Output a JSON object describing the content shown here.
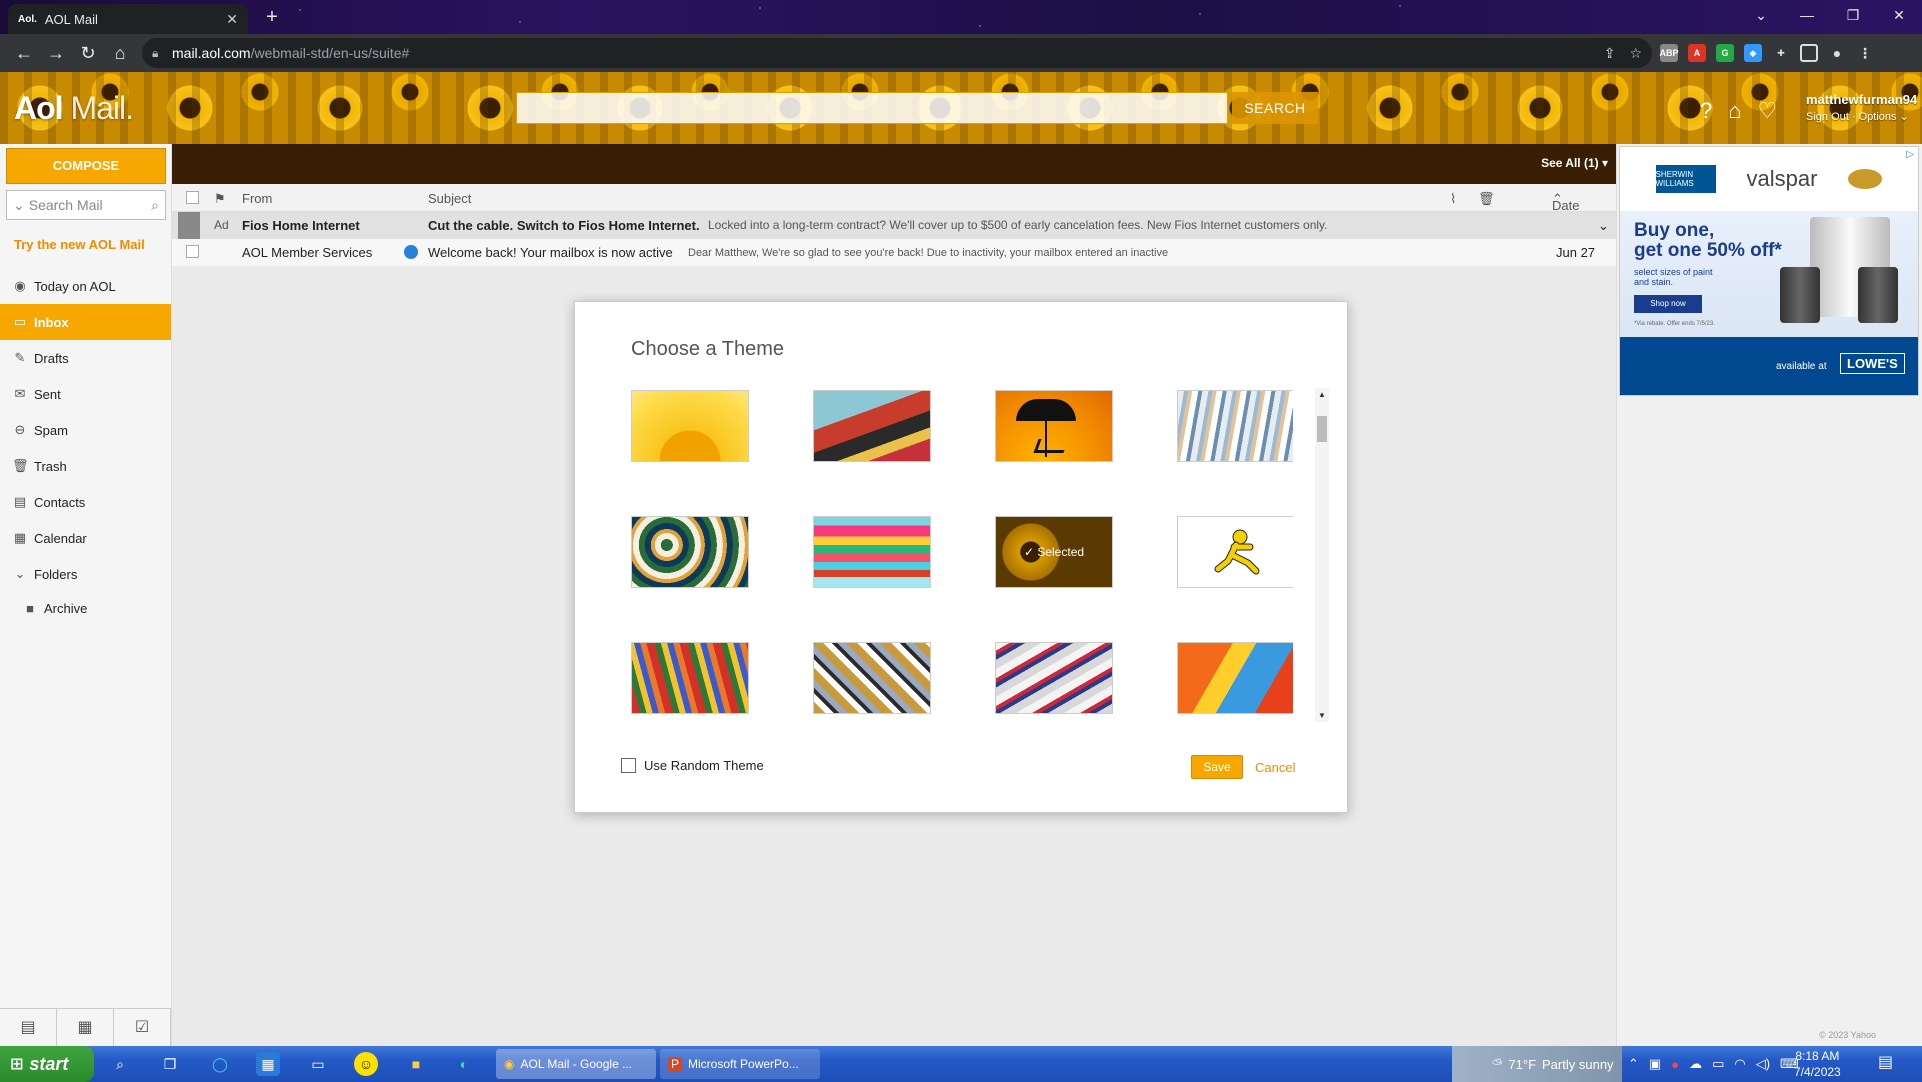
{
  "browser": {
    "tab_title": "AOL Mail",
    "tab_favicon": "Aol.",
    "url_host": "mail.aol.com",
    "url_path": "/webmail-std/en-us/suite#"
  },
  "header": {
    "logo_bold": "Aol",
    "logo_light": "Mail.",
    "search_button": "SEARCH",
    "username": "matthewfurman94",
    "sign_out": "Sign Out",
    "options": "Options"
  },
  "sidebar": {
    "compose": "COMPOSE",
    "search_placeholder": "Search Mail",
    "try_new": "Try the new AOL Mail",
    "items": [
      {
        "label": "Today on AOL",
        "icon": "aol-icon"
      },
      {
        "label": "Inbox",
        "icon": "inbox-icon"
      },
      {
        "label": "Drafts",
        "icon": "drafts-icon"
      },
      {
        "label": "Sent",
        "icon": "sent-icon"
      },
      {
        "label": "Spam",
        "icon": "spam-icon"
      },
      {
        "label": "Trash",
        "icon": "trash-icon"
      },
      {
        "label": "Contacts",
        "icon": "contacts-icon"
      },
      {
        "label": "Calendar",
        "icon": "calendar-icon"
      },
      {
        "label": "Folders",
        "icon": "chevron-down-icon"
      },
      {
        "label": "Archive",
        "icon": "folder-icon"
      }
    ]
  },
  "list": {
    "see_all": "See All (1)",
    "col_from": "From",
    "col_subject": "Subject",
    "col_date": "Date",
    "rows": [
      {
        "tag": "Ad",
        "from": "Fios Home Internet",
        "subject": "Cut the cable. Switch to Fios Home Internet.",
        "preview": "Locked into a long-term contract? We'll cover up to $500 of early cancelation fees. New Fios Internet customers only.",
        "date": ""
      },
      {
        "tag": "",
        "from": "AOL Member Services",
        "subject": "Welcome back! Your mailbox is now active",
        "preview": "Dear Matthew, We're so glad to see you're back! Due to inactivity, your mailbox entered an inactive",
        "date": "Jun 27"
      }
    ]
  },
  "ad": {
    "brand1": "SHERWIN WILLIAMS",
    "brand2": "valspar",
    "headline1": "Buy one,",
    "headline2": "get one 50% off*",
    "sub": "select sizes of paint and stain.",
    "cta": "Shop now",
    "fine": "*Via rebate. Offer ends 7/5/23.",
    "available": "available at",
    "retailer": "LOWE'S",
    "copyright": "© 2023 Yahoo"
  },
  "modal": {
    "title": "Choose a Theme",
    "selected_label": "✓ Selected",
    "random_label": "Use Random Theme",
    "save": "Save",
    "cancel": "Cancel"
  },
  "taskbar": {
    "start": "start",
    "task1": "AOL Mail - Google ...",
    "task2": "Microsoft PowerPo...",
    "weather_temp": "71°F",
    "weather_desc": "Partly sunny",
    "time": "8:18 AM",
    "date": "7/4/2023"
  },
  "colors": {
    "accent": "#f6a800",
    "link_orange": "#f08c00",
    "list_bar": "#3a1e04"
  }
}
